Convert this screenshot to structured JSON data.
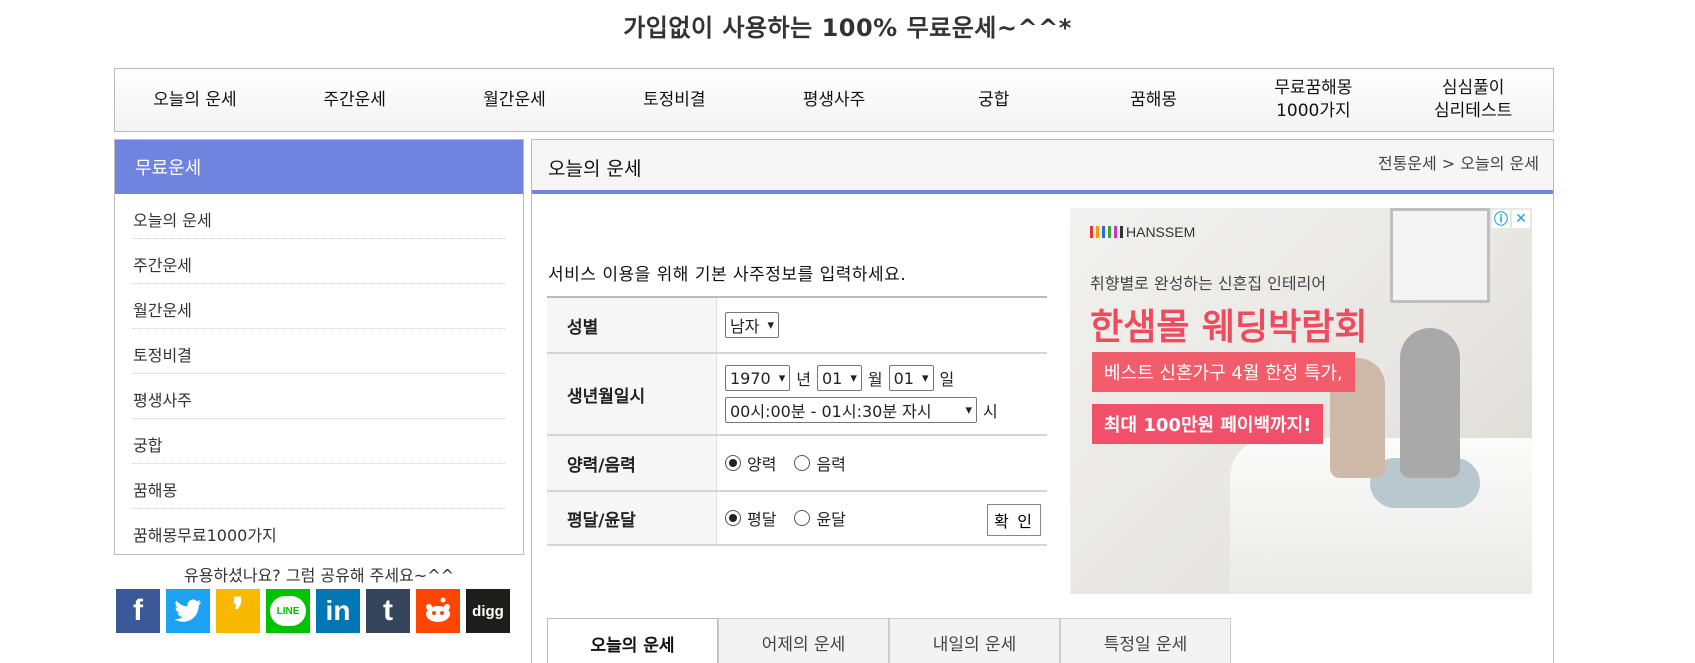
{
  "site": {
    "title": "가입없이 사용하는 100% 무료운세~^^*"
  },
  "topnav": [
    {
      "label": "오늘의 운세"
    },
    {
      "label": "주간운세"
    },
    {
      "label": "월간운세"
    },
    {
      "label": "토정비결"
    },
    {
      "label": "평생사주"
    },
    {
      "label": "궁합"
    },
    {
      "label": "꿈해몽"
    },
    {
      "label": "무료꿈해몽\n1000가지"
    },
    {
      "label": "심심풀이\n심리테스트"
    }
  ],
  "sidebar": {
    "header": "무료운세",
    "items": [
      {
        "label": "오늘의 운세"
      },
      {
        "label": "주간운세"
      },
      {
        "label": "월간운세"
      },
      {
        "label": "토정비결"
      },
      {
        "label": "평생사주"
      },
      {
        "label": "궁합"
      },
      {
        "label": "꿈해몽"
      },
      {
        "label": "꿈해몽무료1000가지"
      }
    ]
  },
  "share": {
    "text": "유용하셨나요? 그럼 공유해 주세요~^^",
    "buttons": [
      {
        "name": "facebook",
        "glyph": "f",
        "color": "#3b5998"
      },
      {
        "name": "twitter",
        "glyph": "🐦",
        "color": "#1da1f2"
      },
      {
        "name": "kakaostory",
        "glyph": "❜",
        "color": "#f9b900"
      },
      {
        "name": "line",
        "glyph": "LINE",
        "color": "#00c300"
      },
      {
        "name": "linkedin",
        "glyph": "in",
        "color": "#0077b5"
      },
      {
        "name": "tumblr",
        "glyph": "t",
        "color": "#35465c"
      },
      {
        "name": "reddit",
        "glyph": "●",
        "color": "#ff4500"
      },
      {
        "name": "digg",
        "glyph": "digg",
        "color": "#1d1d1b"
      }
    ]
  },
  "content": {
    "title": "오늘의 운세",
    "breadcrumb": "전통운세 > 오늘의 운세",
    "intro": "서비스 이용을 위해 기본 사주정보를 입력하세요."
  },
  "form": {
    "gender_label": "성별",
    "gender_value": "남자",
    "birth_label": "생년월일시",
    "year_value": "1970",
    "year_unit": "년",
    "month_value": "01",
    "month_unit": "월",
    "day_value": "01",
    "day_unit": "일",
    "time_value": "00시:00분 - 01시:30분 자시",
    "time_unit": "시",
    "calendar_label": "양력/음력",
    "solar": "양력",
    "lunar": "음력",
    "leap_label": "평달/윤달",
    "normal_month": "평달",
    "leap_month": "윤달",
    "confirm": "확 인"
  },
  "ad": {
    "brand": "HANSSEM",
    "sub": "취향별로 완성하는 신혼집 인테리어",
    "headline": "한샘몰 웨딩박람회",
    "box1": "베스트 신혼가구 4월 한정 특가,",
    "box2": "최대 100만원 페이백까지!"
  },
  "tabs": [
    {
      "label": "오늘의 운세"
    },
    {
      "label": "어제의 운세"
    },
    {
      "label": "내일의 운세"
    },
    {
      "label": "특정일 운세"
    }
  ]
}
